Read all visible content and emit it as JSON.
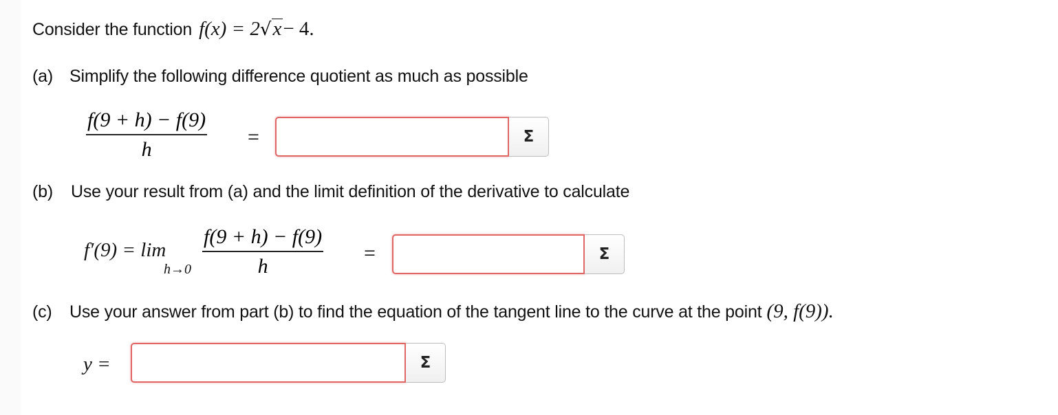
{
  "intro": {
    "text": "Consider the function",
    "func_lhs": "f(x) = 2",
    "radicand": "x",
    "func_rest": " − 4."
  },
  "part_a": {
    "label": "(a)",
    "instruction": "Simplify the following difference quotient as much as possible",
    "numerator": "f(9 + h) − f(9)",
    "denominator": "h",
    "equals": "=",
    "answer_value": "",
    "sigma_label": "Σ"
  },
  "part_b": {
    "label": "(b)",
    "instruction": "Use your result from (a) and the limit definition of the derivative to calculate",
    "lhs": "f′(9) = lim",
    "limit_sub": "h→0",
    "numerator": "f(9 + h) − f(9)",
    "denominator": "h",
    "equals": "=",
    "answer_value": "",
    "sigma_label": "Σ"
  },
  "part_c": {
    "label": "(c)",
    "instruction": "Use your answer from part (b) to find the equation of the tangent line to the curve at the point",
    "point": "(9, f(9)).",
    "lhs": "y =",
    "answer_value": "",
    "sigma_label": "Σ"
  },
  "colors": {
    "input_border": "#e06666",
    "text": "#111111"
  }
}
